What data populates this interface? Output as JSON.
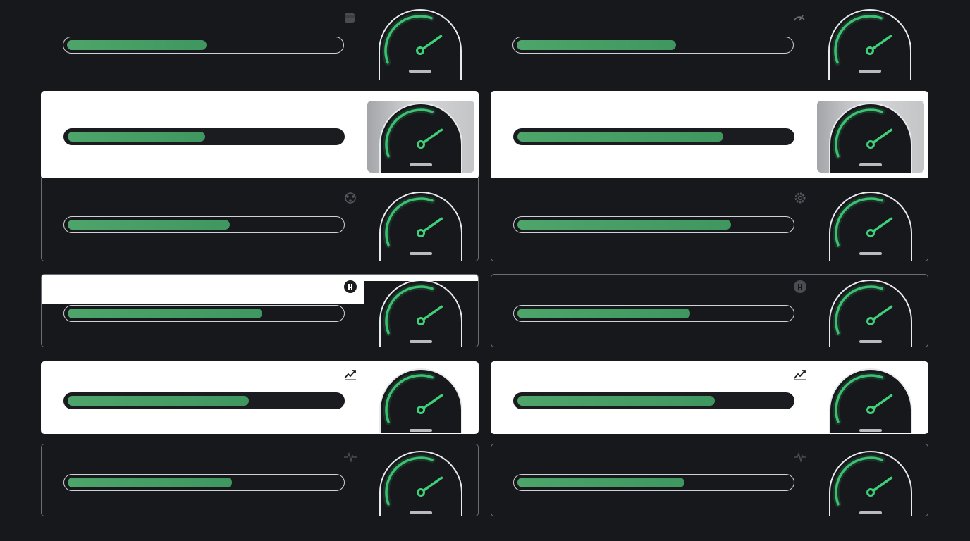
{
  "colors": {
    "background": "#17181c",
    "card_light": "#ffffff",
    "accent_green": "#3fd17a",
    "bar_fill": "#4ea56a"
  },
  "rows": [
    {
      "cells": [
        {
          "level_percent": 51,
          "gauge_percent": 62,
          "icon": "coins-icon"
        },
        {
          "level_percent": 58,
          "gauge_percent": 62,
          "icon": "speedometer-icon"
        }
      ]
    },
    {
      "cells": [
        {
          "level_percent": 50,
          "gauge_percent": 62,
          "icon": ""
        },
        {
          "level_percent": 75,
          "gauge_percent": 62,
          "icon": ""
        }
      ]
    },
    {
      "cells": [
        {
          "level_percent": 59,
          "gauge_percent": 62,
          "icon": "network-cycle-icon"
        },
        {
          "level_percent": 78,
          "gauge_percent": 62,
          "icon": "gear-icon"
        }
      ]
    },
    {
      "cells": [
        {
          "level_percent": 71,
          "gauge_percent": 62,
          "icon": "arm-flex-icon"
        },
        {
          "level_percent": 63,
          "gauge_percent": 62,
          "icon": "arm-flex-icon"
        }
      ]
    },
    {
      "cells": [
        {
          "level_percent": 66,
          "gauge_percent": 62,
          "icon": "trend-up-icon"
        },
        {
          "level_percent": 72,
          "gauge_percent": 62,
          "icon": "trend-up-icon"
        }
      ]
    },
    {
      "cells": [
        {
          "level_percent": 60,
          "gauge_percent": 62,
          "icon": "heartbeat-icon"
        },
        {
          "level_percent": 61,
          "gauge_percent": 62,
          "icon": "heartbeat-icon"
        }
      ]
    }
  ]
}
